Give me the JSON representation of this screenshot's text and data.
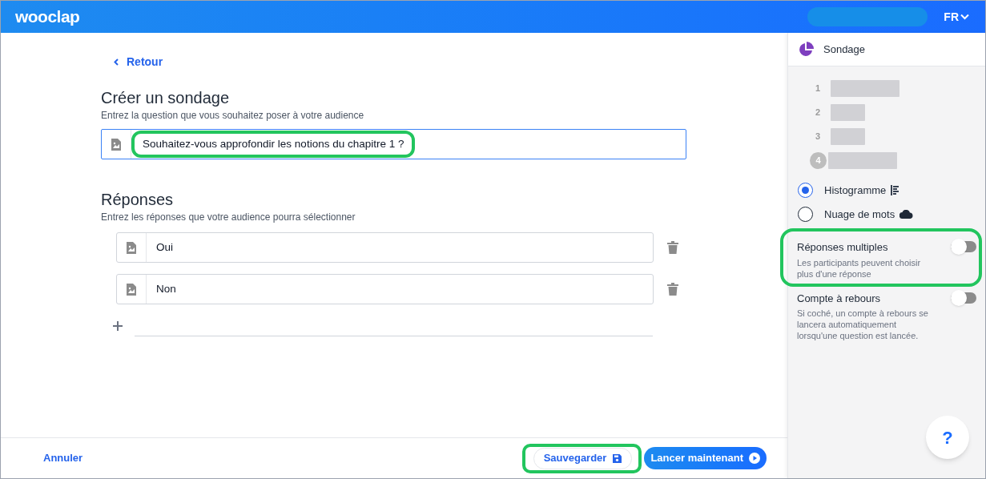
{
  "header": {
    "logo": "wooclap",
    "language": "FR"
  },
  "back_link": "Retour",
  "question": {
    "title": "Créer un sondage",
    "subtitle": "Entrez la question que vous souhaitez poser à votre audience",
    "value": "Souhaitez-vous approfondir les notions du chapitre 1 ?",
    "highlighted": true
  },
  "answers": {
    "title": "Réponses",
    "subtitle": "Entrez les réponses que votre audience pourra sélectionner",
    "items": [
      {
        "value": "Oui"
      },
      {
        "value": "Non"
      }
    ]
  },
  "footer": {
    "cancel": "Annuler",
    "save": {
      "label": "Sauvegarder",
      "highlighted": true
    },
    "launch": "Lancer maintenant"
  },
  "sidebar": {
    "type": "Sondage",
    "preview": [
      {
        "rank": "1",
        "selected": false
      },
      {
        "rank": "2",
        "selected": false
      },
      {
        "rank": "3",
        "selected": false
      },
      {
        "rank": "4",
        "selected": true
      }
    ],
    "chart_types": [
      {
        "label": "Histogramme",
        "kind": "histogram",
        "selected": true
      },
      {
        "label": "Nuage de mots",
        "kind": "cloud",
        "selected": false
      }
    ],
    "options": [
      {
        "label": "Réponses multiples",
        "description": "Les participants peuvent choisir plus d'une réponse",
        "on": false,
        "highlighted": true
      },
      {
        "label": "Compte à rebours",
        "description": "Si coché, un compte à rebours se lancera automatiquement lorsqu'une question est lancée.",
        "on": false
      }
    ]
  },
  "help": "?"
}
